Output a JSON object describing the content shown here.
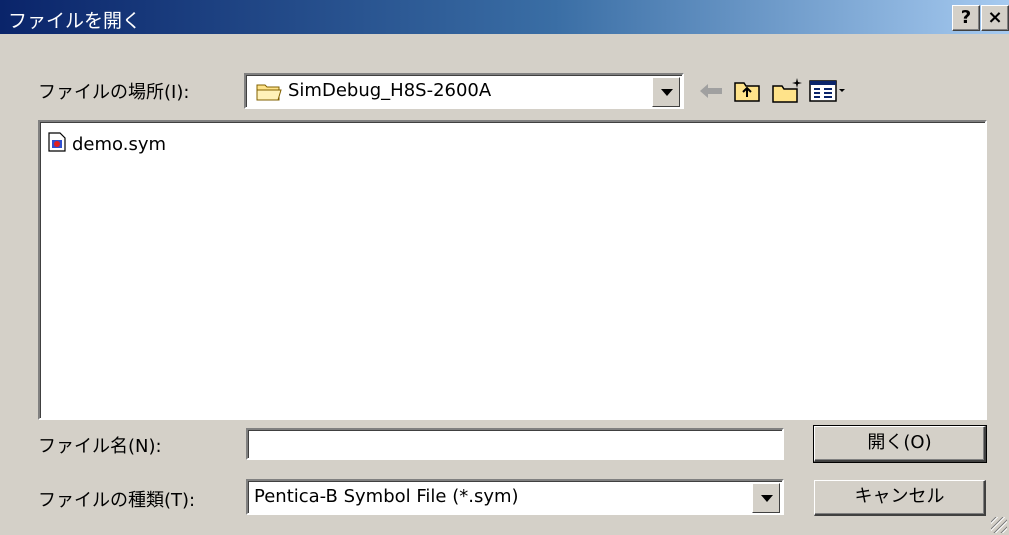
{
  "window": {
    "title": "ファイルを開く",
    "help_label": "?",
    "close_label": "×"
  },
  "look_in": {
    "label": "ファイルの場所(I):",
    "value": "SimDebug_H8S-2600A"
  },
  "files": [
    {
      "name": "demo.sym",
      "icon": "symbol-file-icon"
    }
  ],
  "filename": {
    "label": "ファイル名(N):",
    "value": ""
  },
  "filetype": {
    "label": "ファイルの種類(T):",
    "value": "Pentica-B Symbol File (*.sym)"
  },
  "buttons": {
    "open": "開く(O)",
    "cancel": "キャンセル"
  },
  "toolbar": {
    "icons": [
      "back-arrow-icon",
      "up-folder-icon",
      "new-folder-icon",
      "view-menu-icon"
    ]
  },
  "colors": {
    "title_start": "#0a246a",
    "title_end": "#a6caf0",
    "face": "#d4d0c8"
  }
}
